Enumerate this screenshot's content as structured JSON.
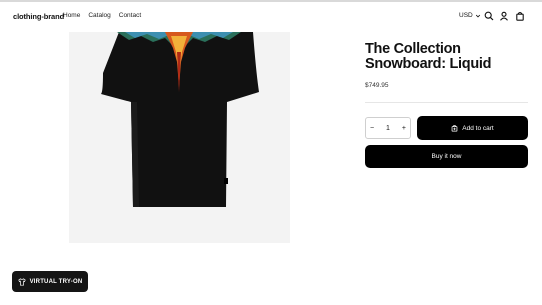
{
  "header": {
    "brand": "clothing-brand",
    "nav": [
      "Home",
      "Catalog",
      "Contact"
    ],
    "currency": "USD",
    "icons": [
      "search-icon",
      "account-icon",
      "cart-icon"
    ]
  },
  "product": {
    "title": "The Collection Snowboard: Liquid",
    "price": "$749.95",
    "quantity": "1",
    "quantity_decrease": "−",
    "quantity_increase": "+",
    "add_to_cart_label": "Add to cart",
    "buy_now_label": "Buy it now",
    "image": "black t-shirt with wing print"
  },
  "tryon": {
    "label": "VIRTUAL TRY-ON"
  },
  "colors": {
    "background": "#ffffff",
    "button": "#000000",
    "gallery_bg": "#f3f3f3"
  }
}
